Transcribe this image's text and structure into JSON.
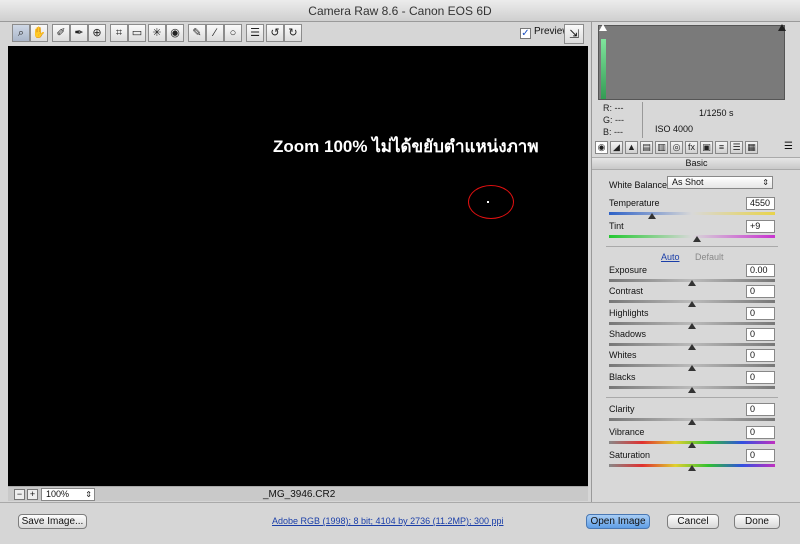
{
  "window": {
    "title": "Camera Raw 8.6  -  Canon EOS 6D"
  },
  "toolbar": {
    "tools": [
      {
        "name": "zoom-tool-icon",
        "glyph": "⌕"
      },
      {
        "name": "hand-tool-icon",
        "glyph": "✋"
      },
      {
        "name": "white-balance-tool-icon",
        "glyph": "✐"
      },
      {
        "name": "color-sampler-tool-icon",
        "glyph": "✒"
      },
      {
        "name": "targeted-adjustment-tool-icon",
        "glyph": "⊕"
      },
      {
        "name": "crop-tool-icon",
        "glyph": "⌗"
      },
      {
        "name": "straighten-tool-icon",
        "glyph": "▭"
      },
      {
        "name": "spot-removal-tool-icon",
        "glyph": "✳"
      },
      {
        "name": "red-eye-tool-icon",
        "glyph": "◉"
      },
      {
        "name": "adjustment-brush-icon",
        "glyph": "✎"
      },
      {
        "name": "graduated-filter-icon",
        "glyph": "∕"
      },
      {
        "name": "radial-filter-icon",
        "glyph": "○"
      },
      {
        "name": "preferences-icon",
        "glyph": "☰"
      },
      {
        "name": "rotate-left-icon",
        "glyph": "↺"
      },
      {
        "name": "rotate-right-icon",
        "glyph": "↻"
      }
    ],
    "preview_label": "Preview",
    "preview_checked": true
  },
  "canvas": {
    "annotation": "Zoom 100% ไม่ได้ขยับตำแหน่งภาพ"
  },
  "status": {
    "zoom_value": "100%",
    "filename": "_MG_3946.CR2"
  },
  "histogram": {
    "r_label": "R:",
    "g_label": "G:",
    "b_label": "B:",
    "r_value": "---",
    "g_value": "---",
    "b_value": "---",
    "shutter": "1/1250 s",
    "iso": "ISO 4000"
  },
  "panel": {
    "title": "Basic",
    "white_balance_label": "White Balance:",
    "white_balance_value": "As Shot",
    "auto_label": "Auto",
    "default_label": "Default",
    "sliders": [
      {
        "key": "temperature",
        "label": "Temperature",
        "value": "4550",
        "fraction": 0.26,
        "track": "temp"
      },
      {
        "key": "tint",
        "label": "Tint",
        "value": "+9",
        "fraction": 0.53,
        "track": "tint"
      },
      {
        "key": "exposure",
        "label": "Exposure",
        "value": "0.00",
        "fraction": 0.5,
        "track": "mid"
      },
      {
        "key": "contrast",
        "label": "Contrast",
        "value": "0",
        "fraction": 0.5,
        "track": "mid"
      },
      {
        "key": "highlights",
        "label": "Highlights",
        "value": "0",
        "fraction": 0.5,
        "track": "mid"
      },
      {
        "key": "shadows",
        "label": "Shadows",
        "value": "0",
        "fraction": 0.5,
        "track": "mid"
      },
      {
        "key": "whites",
        "label": "Whites",
        "value": "0",
        "fraction": 0.5,
        "track": "mid"
      },
      {
        "key": "blacks",
        "label": "Blacks",
        "value": "0",
        "fraction": 0.5,
        "track": "mid"
      },
      {
        "key": "clarity",
        "label": "Clarity",
        "value": "0",
        "fraction": 0.5,
        "track": "mid"
      },
      {
        "key": "vibrance",
        "label": "Vibrance",
        "value": "0",
        "fraction": 0.5,
        "track": "sat"
      },
      {
        "key": "saturation",
        "label": "Saturation",
        "value": "0",
        "fraction": 0.5,
        "track": "sat"
      }
    ]
  },
  "footer": {
    "save_label": "Save Image...",
    "workflow_text": "Adobe RGB (1998); 8 bit; 4104 by 2736 (11.2MP); 300 ppi",
    "open_label": "Open Image",
    "cancel_label": "Cancel",
    "done_label": "Done"
  },
  "colors": {
    "accent": "#5f9ee6",
    "annotation_circle": "#e01010",
    "canvas": "#000000"
  }
}
